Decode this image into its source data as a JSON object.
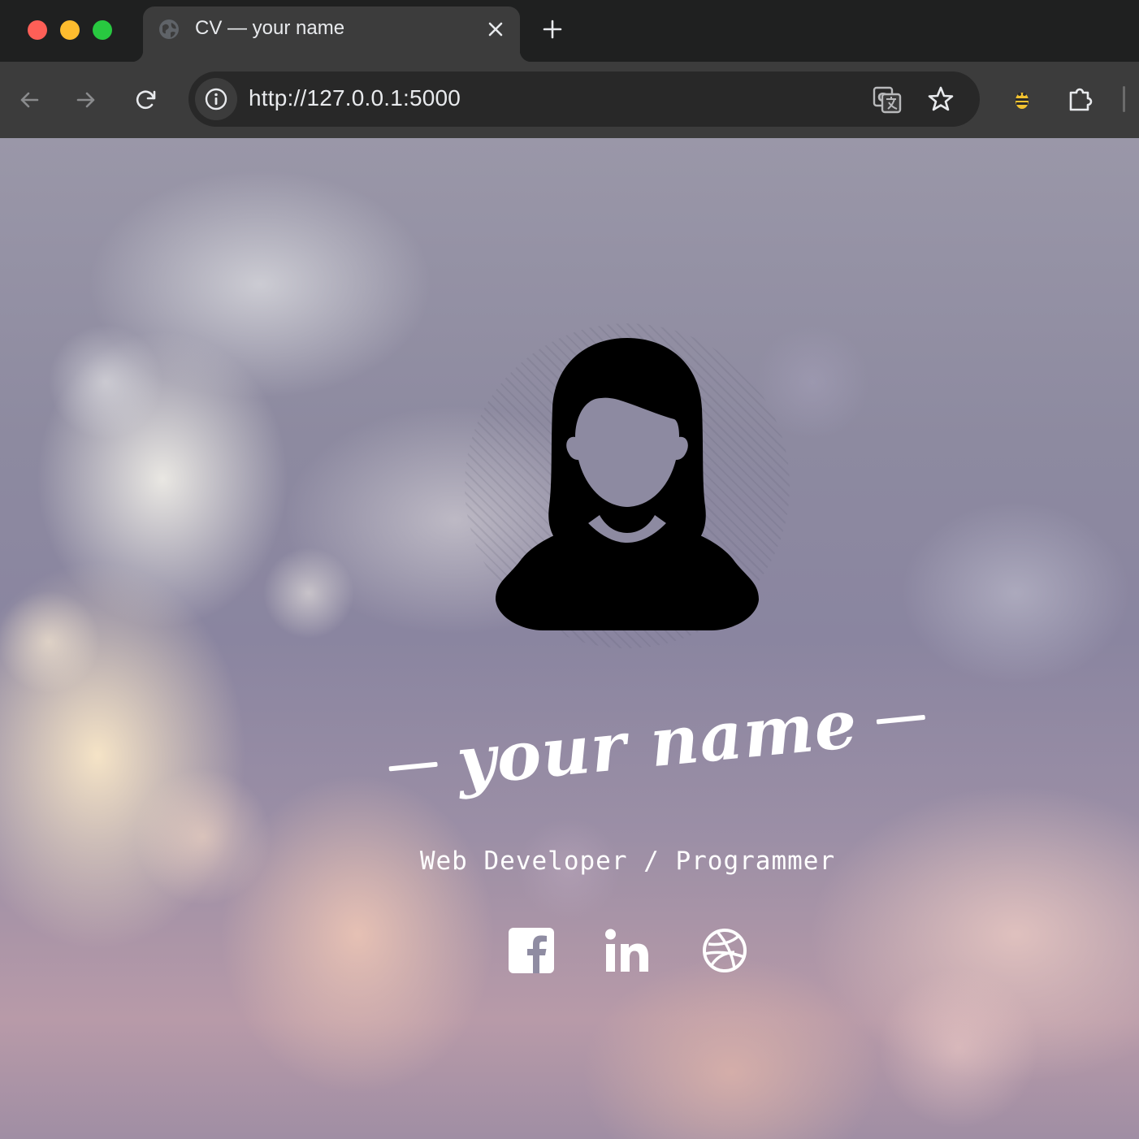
{
  "browser": {
    "tab_title": "CV — your name",
    "url": "http://127.0.0.1:5000"
  },
  "page": {
    "name": "your name",
    "subtitle": "Web Developer / Programmer",
    "socials": [
      "facebook-icon",
      "linkedin-icon",
      "dribbble-icon"
    ]
  },
  "colors": {
    "tab_bar": "#1f2020",
    "toolbar": "#3c3c3c",
    "omnibox": "#282828",
    "text_primary": "#ffffff"
  }
}
